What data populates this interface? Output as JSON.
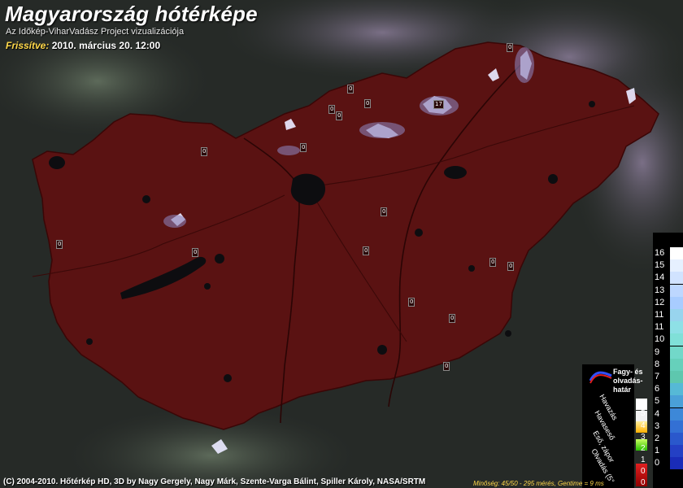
{
  "header": {
    "title": "Magyarország hótérképe",
    "subtitle": "Az Időkép-ViharVadász Project vizualizációja",
    "updated_label": "Frissítve:",
    "updated_value": "2010. március 20. 12:00"
  },
  "stations": [
    "0",
    "0",
    "0",
    "0",
    "0",
    "17",
    "0",
    "0",
    "0",
    "0",
    "0",
    "0",
    "0",
    "0",
    "0",
    "0",
    "0",
    "0",
    "0"
  ],
  "legend": {
    "frost_label": [
      "Fagy- és",
      "olvadás-",
      "határ"
    ],
    "categories": [
      {
        "label": "Havazás",
        "color": "#ffffff"
      },
      {
        "label": "Havaseső",
        "color": "#ffd36b"
      },
      {
        "label": "Eső, zápor",
        "color": "#44e000"
      },
      {
        "label": "Olvadás (5°",
        "color": "#d00000"
      }
    ],
    "numbers": [
      "5",
      "5",
      "4",
      "3",
      "2",
      "1",
      "0",
      "0"
    ]
  },
  "scale": {
    "values": [
      "16",
      "15",
      "14",
      "13",
      "12",
      "11",
      "11",
      "10",
      "9",
      "8",
      "7",
      "6",
      "5",
      "4",
      "3",
      "2",
      "1",
      "0"
    ],
    "colors": [
      "#ffffff",
      "#e6f0ff",
      "#d1e3ff",
      "#bdd7ff",
      "#a8ccff",
      "#98d4ee",
      "#8ee0e6",
      "#80e0d8",
      "#72d8c9",
      "#66d0bb",
      "#5ec7ae",
      "#56b9d6",
      "#4aa0d8",
      "#3d88d8",
      "#3370d4",
      "#2a58cc",
      "#2440c4",
      "#1a2cb8"
    ]
  },
  "footer": {
    "credits": "(C) 2004-2010. Hőtérkép HD, 3D by Nagy Gergely, Nagy Márk, Szente-Varga Bálint, Spiller Károly, NASA/SRTM",
    "quality": "Minőség: 45/50 - 295 mérés, Gentime = 9 ms"
  },
  "colors": {
    "country_fill": "#5a1212",
    "snow": "#f0f0ff",
    "surroundings": "#2b2f2c"
  }
}
